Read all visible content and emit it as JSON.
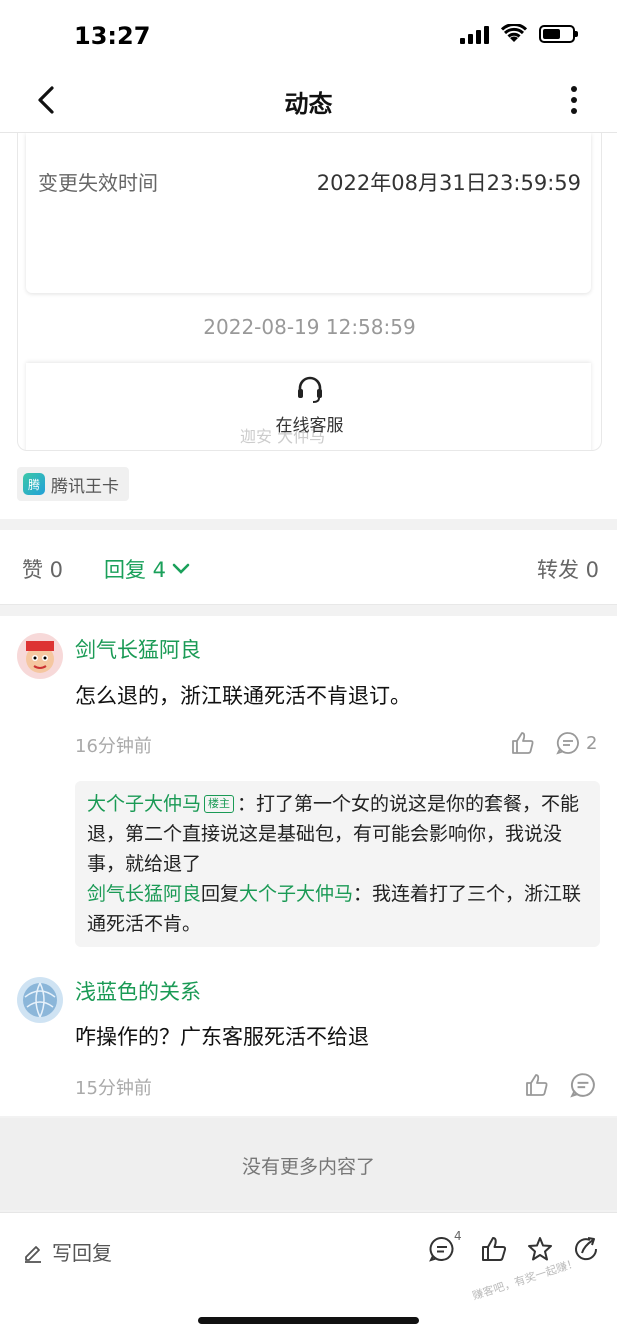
{
  "status_bar": {
    "time": "13:27",
    "battery_level": 0.6
  },
  "nav": {
    "title": "动态"
  },
  "card": {
    "row_label": "变更失效时间",
    "row_value": "2022年08月31日23:59:59",
    "timestamp": "2022-08-19 12:58:59",
    "customer_service_label": "在线客服",
    "faded_text": "迦安 大仲马"
  },
  "tag": {
    "logo_char": "腾",
    "label": "腾讯王卡"
  },
  "actions": {
    "like": "赞 0",
    "reply": "回复 4",
    "share": "转发 0"
  },
  "comments": [
    {
      "name": "剑气长猛阿良",
      "text": "怎么退的，浙江联通死活不肯退订。",
      "time": "16分钟前",
      "reply_count": "2",
      "subreplies": [
        {
          "author": "大个子大仲马",
          "badge": "楼主",
          "text": "：打了第一个女的说这是你的套餐，不能退，第二个直接说这是基础包，有可能会影响你，我说没事，就给退了"
        },
        {
          "author": "剑气长猛阿良",
          "reply_word": "回复",
          "target": "大个子大仲马",
          "text": "：我连着打了三个，浙江联通死活不肯。"
        }
      ]
    },
    {
      "name": "浅蓝色的关系",
      "text": "咋操作的？广东客服死活不给退",
      "time": "15分钟前"
    }
  ],
  "no_more": "没有更多内容了",
  "bottom": {
    "write_reply": "写回复",
    "comment_count": "4",
    "watermark": "赚客吧，有奖一起赚！"
  },
  "colors": {
    "accent": "#1a9a55"
  }
}
